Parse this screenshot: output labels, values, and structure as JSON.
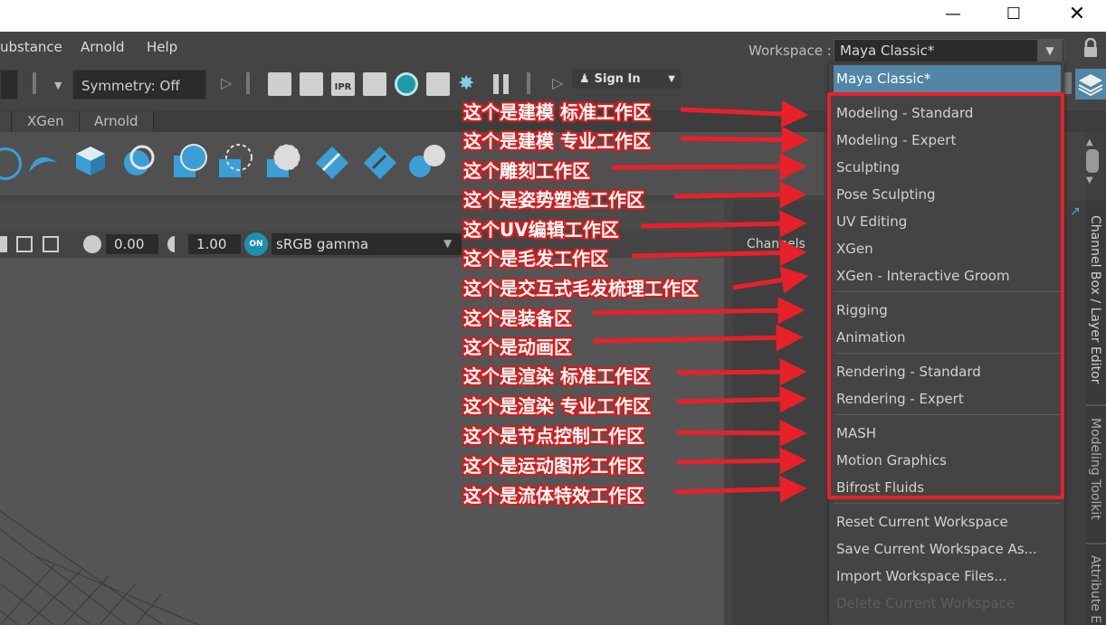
{
  "menu": {
    "items": [
      "ubstance",
      "Arnold",
      "Help"
    ],
    "workspace_label": "Workspace :",
    "workspace_value": "Maya Classic*"
  },
  "toolbar": {
    "symmetry": "Symmetry: Off",
    "sign_in": "Sign In",
    "ipr_label": "IPR"
  },
  "shelf_tabs": [
    "XGen",
    "Arnold"
  ],
  "viewport": {
    "exposure": "0.00",
    "gamma": "1.00",
    "on_badge": "ON",
    "color_space": "sRGB gamma"
  },
  "right_panel": {
    "channels": "Channels",
    "side_tabs": [
      "Channel Box / Layer Editor",
      "Modeling Toolkit",
      "Attribute E"
    ]
  },
  "dropdown": {
    "selected": "Maya Classic*",
    "workspaces": [
      "Modeling - Standard",
      "Modeling - Expert",
      "Sculpting",
      "Pose Sculpting",
      "UV Editing",
      "XGen",
      "XGen - Interactive Groom",
      "Rigging",
      "Animation",
      "Rendering - Standard",
      "Rendering - Expert",
      "MASH",
      "Motion Graphics",
      "Bifrost Fluids"
    ],
    "actions": [
      "Reset Current Workspace",
      "Save Current Workspace As...",
      "Import Workspace Files...",
      "Delete Current Workspace"
    ]
  },
  "annotations": [
    "这个是建模 标准工作区",
    "这个是建模 专业工作区",
    "这个雕刻工作区",
    "这个是姿势塑造工作区",
    "这个UV编辑工作区",
    "这个是毛发工作区",
    "这个是交互式毛发梳理工作区",
    "这个是装备区",
    "这个是动画区",
    "这个是渲染 标准工作区",
    "这个是渲染 专业工作区",
    "这个是节点控制工作区",
    "这个是运动图形工作区",
    "这个是流体特效工作区"
  ],
  "colors": {
    "highlight": "#5285a6",
    "annotation_red": "#e8202a",
    "menu_bg": "#444444"
  }
}
